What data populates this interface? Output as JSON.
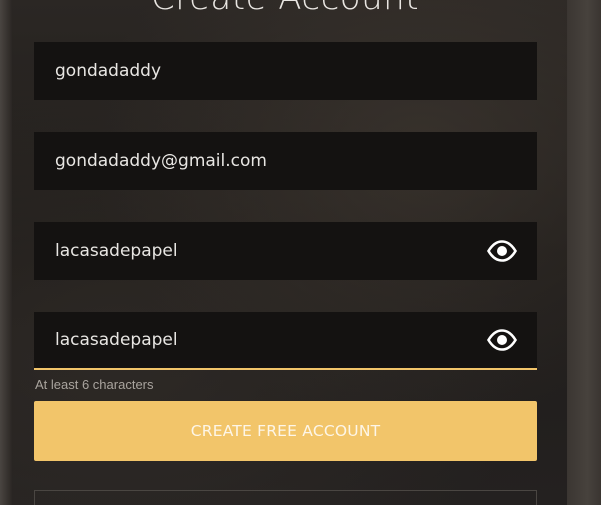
{
  "form": {
    "title": "Create Account",
    "username": {
      "value": "gondadaddy"
    },
    "email": {
      "value": "gondadaddy@gmail.com"
    },
    "password": {
      "value": "lacasadepapel",
      "toggle_icon": "eye-icon"
    },
    "confirm_password": {
      "value": "lacasadepapel",
      "toggle_icon": "eye-icon"
    },
    "hint": "At least 6 characters",
    "submit_label": "CREATE FREE ACCOUNT"
  },
  "colors": {
    "accent": "#f2c56a",
    "field_bg": "#141211",
    "text": "#e8e6e3"
  }
}
